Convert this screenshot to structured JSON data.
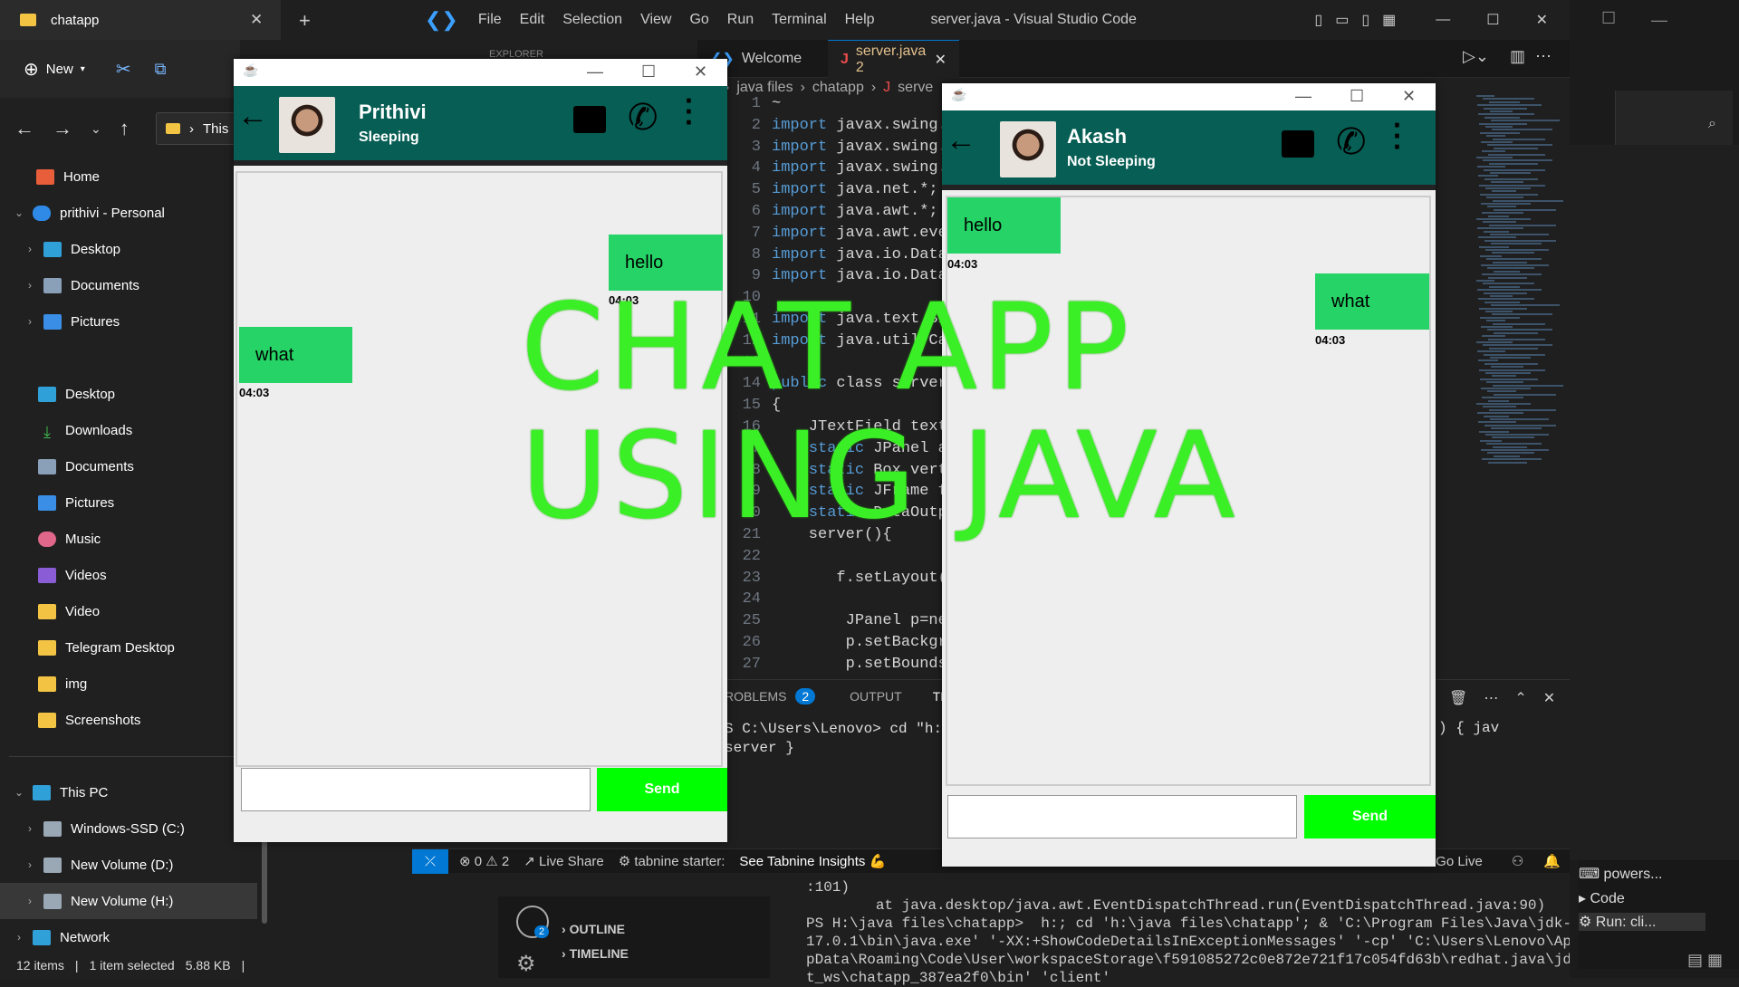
{
  "explorer": {
    "tab_title": "chatapp",
    "new_label": "New",
    "address_crumb": "This",
    "nav_items": [
      {
        "label": "Home"
      },
      {
        "label": "prithivi - Personal"
      },
      {
        "label": "Desktop"
      },
      {
        "label": "Documents"
      },
      {
        "label": "Pictures"
      },
      {
        "label": "Desktop"
      },
      {
        "label": "Downloads"
      },
      {
        "label": "Documents"
      },
      {
        "label": "Pictures"
      },
      {
        "label": "Music"
      },
      {
        "label": "Videos"
      },
      {
        "label": "Video"
      },
      {
        "label": "Telegram Desktop"
      },
      {
        "label": "img"
      },
      {
        "label": "Screenshots"
      },
      {
        "label": "This PC"
      },
      {
        "label": "Windows-SSD (C:)"
      },
      {
        "label": "New Volume (D:)"
      },
      {
        "label": "New Volume (H:)"
      },
      {
        "label": "Network"
      }
    ],
    "status": {
      "items": "12 items",
      "selected": "1 item selected",
      "size": "5.88 KB"
    }
  },
  "vscode": {
    "menu": [
      "File",
      "Edit",
      "Selection",
      "View",
      "Go",
      "Run",
      "Terminal",
      "Help"
    ],
    "window_title": "server.java - Visual Studio Code",
    "explorer_label": "EXPLORER",
    "tabs": {
      "welcome": "Welcome",
      "server": "server.java 2"
    },
    "breadcrumb": {
      "a": "java files",
      "b": "chatapp",
      "c": "serve"
    },
    "code_lines": [
      {
        "n": "1",
        "t": "~"
      },
      {
        "n": "2",
        "t": "import javax.swing.*"
      },
      {
        "n": "3",
        "t": "import javax.swing.b"
      },
      {
        "n": "4",
        "t": "import javax.swing.b"
      },
      {
        "n": "5",
        "t": "import java.net.*;"
      },
      {
        "n": "6",
        "t": "import java.awt.*;"
      },
      {
        "n": "7",
        "t": "import java.awt.ever"
      },
      {
        "n": "8",
        "t": "import java.io.Datal"
      },
      {
        "n": "9",
        "t": "import java.io.DataC"
      },
      {
        "n": "10",
        "t": ""
      },
      {
        "n": "11",
        "t": "import java.text.Sim"
      },
      {
        "n": "12",
        "t": "import java.util.Cal"
      },
      {
        "n": "13",
        "t": ""
      },
      {
        "n": "14",
        "t": "public class server"
      },
      {
        "n": "15",
        "t": "{"
      },
      {
        "n": "16",
        "t": "    JTextField text;"
      },
      {
        "n": "17",
        "t": "    static JPanel a1"
      },
      {
        "n": "18",
        "t": "    static Box verti"
      },
      {
        "n": "19",
        "t": "    static JFrame f="
      },
      {
        "n": "20",
        "t": "    static DataOutpu"
      },
      {
        "n": "21",
        "t": "    server(){"
      },
      {
        "n": "22",
        "t": ""
      },
      {
        "n": "23",
        "t": "       f.setLayout(n"
      },
      {
        "n": "24",
        "t": ""
      },
      {
        "n": "25",
        "t": "        JPanel p=new"
      },
      {
        "n": "26",
        "t": "        p.setBackgro"
      },
      {
        "n": "27",
        "t": "        p.setBounds("
      }
    ],
    "panel_tabs": {
      "problems": "ROBLEMS",
      "problems_count": "2",
      "output": "OUTPUT",
      "terminal": "TERMI"
    },
    "terminal_lines": [
      "S C:\\Users\\Lenovo> cd \"h:\\j",
      " server }"
    ],
    "terminal_right": ") { jav",
    "terminal_out": [
      ":101)",
      "        at java.desktop/java.awt.EventDispatchThread.run(EventDispatchThread.java:90)",
      "PS H:\\java files\\chatapp>  h:; cd 'h:\\java files\\chatapp'; & 'C:\\Program Files\\Java\\jdk-",
      "17.0.1\\bin\\java.exe' '-XX:+ShowCodeDetailsInExceptionMessages' '-cp' 'C:\\Users\\Lenovo\\Ap",
      "pData\\Roaming\\Code\\User\\workspaceStorage\\f591085272c0e872e721f17c054fd63b\\redhat.java\\jd",
      "t_ws\\chatapp_387ea2f0\\bin' 'client'"
    ],
    "status": {
      "errors": "0",
      "warnings": "2",
      "liveshare": "Live Share",
      "tabnine": "tabnine starter:",
      "insights": "See Tabnine Insights",
      "golive": "Go Live"
    },
    "side_sections": {
      "outline": "OUTLINE",
      "timeline": "TIMELINE"
    },
    "account_badge": "2",
    "terminal_list": [
      "powers...",
      "Code",
      "Run: cli..."
    ]
  },
  "chat_left": {
    "name": "Prithivi",
    "status": "Sleeping",
    "messages": [
      {
        "text": "hello",
        "time": "04:03",
        "side": "right"
      },
      {
        "text": "what",
        "time": "04:03",
        "side": "left"
      }
    ],
    "send_label": "Send"
  },
  "chat_right": {
    "name": "Akash",
    "status": "Not Sleeping",
    "messages": [
      {
        "text": "hello",
        "time": "04:03",
        "side": "left"
      },
      {
        "text": "what",
        "time": "04:03",
        "side": "right"
      }
    ],
    "send_label": "Send"
  },
  "overlay": {
    "line1": "CHAT APP",
    "line2": "USING JAVA"
  },
  "colors": {
    "chat_header": "#075e54",
    "bubble": "#25d366",
    "send": "#00ff00",
    "overlay_text": "#3bef26",
    "vscode_accent": "#0078d4"
  }
}
